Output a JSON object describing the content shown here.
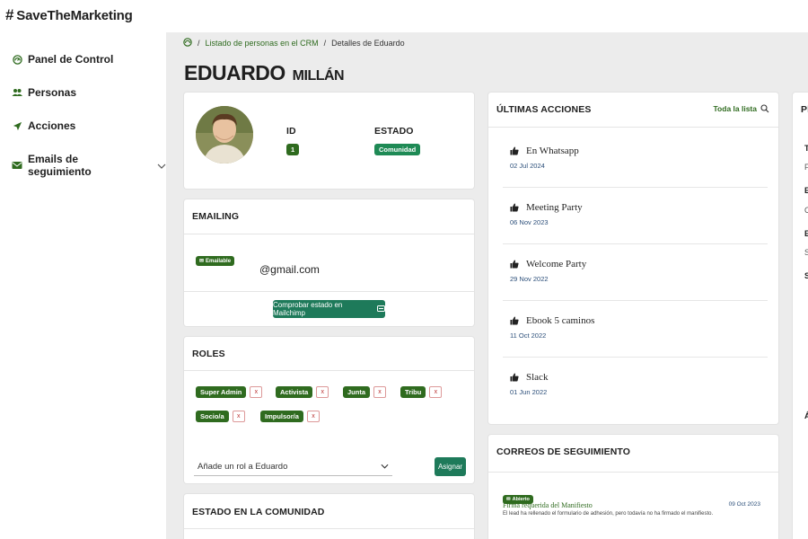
{
  "app": {
    "brand": "SaveTheMarketing"
  },
  "sidebar": {
    "items": [
      {
        "label": "Panel de Control",
        "icon": "dashboard-icon"
      },
      {
        "label": "Personas",
        "icon": "people-icon"
      },
      {
        "label": "Acciones",
        "icon": "send-icon"
      },
      {
        "label": "Emails de seguimiento",
        "icon": "email-icon"
      }
    ]
  },
  "breadcrumb": {
    "parent": "Listado de personas en el CRM",
    "current": "Detalles de Eduardo"
  },
  "person": {
    "first_name": "EDUARDO",
    "last_name": "MILLÁN",
    "id_label": "ID",
    "id_value": "1",
    "estado_label": "ESTADO",
    "estado_value": "Comunidad"
  },
  "emailing": {
    "title": "EMAILING",
    "badge": "Emailable",
    "email": "@gmail.com",
    "check_button": "Comprobar estado en Mailchimp"
  },
  "roles": {
    "title": "ROLES",
    "items": [
      "Super Admin",
      "Activista",
      "Junta",
      "Tribu",
      "Socio/a",
      "Impulsor/a"
    ],
    "remove_symbol": "x",
    "select_placeholder": "Añade un rol a Eduardo",
    "assign_button": "Asignar"
  },
  "community": {
    "title": "ESTADO EN LA COMUNIDAD"
  },
  "last_actions": {
    "title": "ÚLTIMAS ACCIONES",
    "see_all": "Toda la lista",
    "items": [
      {
        "name": "En Whatsapp",
        "date": "02 Jul 2024"
      },
      {
        "name": "Meeting Party",
        "date": "06 Nov 2023"
      },
      {
        "name": "Welcome Party",
        "date": "29 Nov 2022"
      },
      {
        "name": "Ebook 5 caminos",
        "date": "11 Oct 2022"
      },
      {
        "name": "Slack",
        "date": "01 Jun 2022"
      }
    ]
  },
  "followups": {
    "title": "CORREOS DE SEGUIMIENTO",
    "item": {
      "badge": "Abierto",
      "subject": "Firma requerida del Manifiesto",
      "date": "09 Oct 2023",
      "body": "El lead ha rellenado el formulario de adhesión, pero todavía no ha firmado el manifiesto."
    }
  },
  "right_panel": {
    "title_partial": "Pl",
    "letters": [
      "T",
      "F",
      "E",
      "C",
      "E",
      "S",
      "S",
      "Á"
    ]
  },
  "colors": {
    "brand_green": "#2f6b1f",
    "button_green": "#1e7a5a",
    "date_blue": "#2c4f7a"
  }
}
